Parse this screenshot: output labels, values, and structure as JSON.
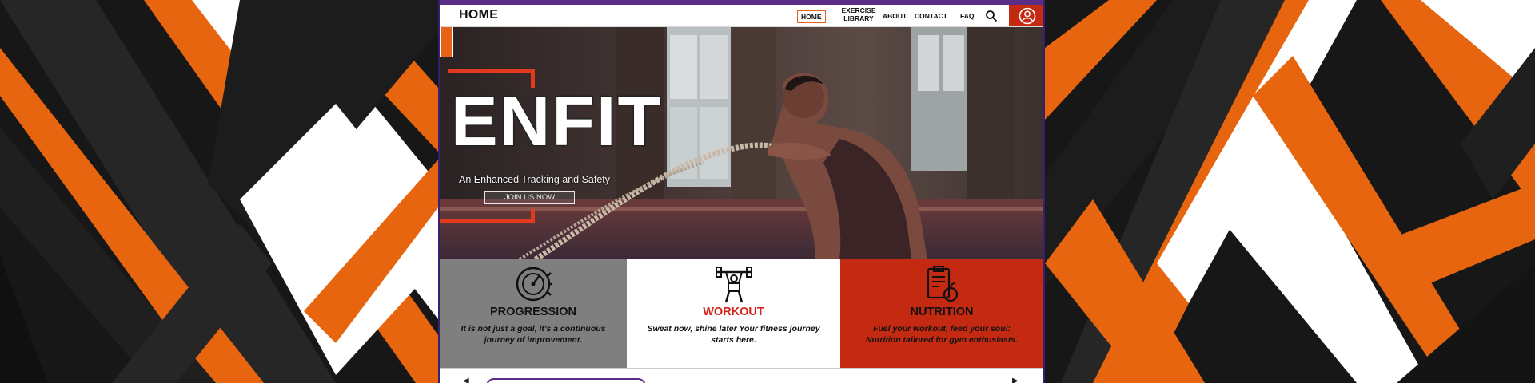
{
  "page_title": "HOME",
  "nav": {
    "home": "HOME",
    "exercise_line1": "EXERCISE",
    "exercise_line2": "LIBRARY",
    "about": "ABOUT",
    "contact": "CONTACT",
    "faq": "FAQ",
    "search_icon": "search-icon",
    "account_icon": "user-account-icon"
  },
  "hero": {
    "title": "ENFIT",
    "subtitle": "An Enhanced Tracking and Safety",
    "cta": "JOIN US NOW"
  },
  "features": [
    {
      "icon": "progression-gauge-icon",
      "heading": "PROGRESSION",
      "description": "It is not just a goal, it's a continuous journey of improvement."
    },
    {
      "icon": "weightlifting-icon",
      "heading": "WORKOUT",
      "description": "Sweat now, shine later Your fitness journey starts here."
    },
    {
      "icon": "nutrition-clipboard-icon",
      "heading": "NUTRITION",
      "description": "Fuel your workout, feed your soul: Nutrition tailored for gym enthusiasts."
    }
  ],
  "colors": {
    "accent_orange": "#e8621a",
    "accent_red": "#c42a12",
    "frame_purple": "#5a2d86",
    "panel_gray": "#7f7f7f"
  }
}
